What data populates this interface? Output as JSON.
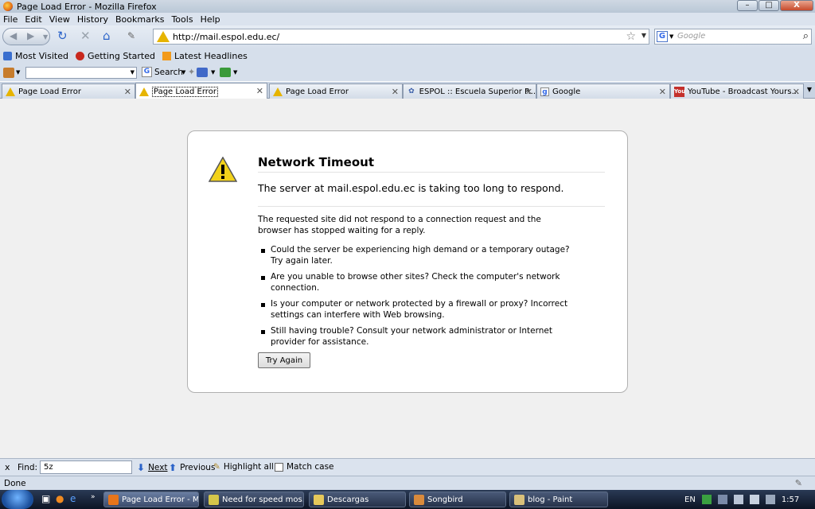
{
  "window": {
    "title": "Page Load Error - Mozilla Firefox",
    "min": "–",
    "max": "□",
    "close": "X"
  },
  "menu": [
    "File",
    "Edit",
    "View",
    "History",
    "Bookmarks",
    "Tools",
    "Help"
  ],
  "nav": {
    "url": "http://mail.espol.edu.ec/",
    "search_placeholder": "Google"
  },
  "bookmarks": [
    "Most Visited",
    "Getting Started",
    "Latest Headlines"
  ],
  "toolbar2": {
    "search_label": "Search"
  },
  "tabs": [
    {
      "label": "Page Load Error",
      "active": false
    },
    {
      "label": "Page Load Error",
      "active": true
    },
    {
      "label": "Page Load Error",
      "active": false
    },
    {
      "label": "ESPOL :: Escuela Superior P...",
      "active": false
    },
    {
      "label": "Google",
      "active": false
    },
    {
      "label": "YouTube - Broadcast Yours...",
      "active": false
    }
  ],
  "error": {
    "title": "Network Timeout",
    "short": "The server at mail.espol.edu.ec is taking too long to respond.",
    "long": "The requested site did not respond to a connection request and the browser has stopped waiting for a reply.",
    "items": [
      "Could the server be experiencing high demand or a temporary outage? Try again later.",
      "Are you unable to browse other sites? Check the computer's network connection.",
      "Is your computer or network protected by a firewall or proxy? Incorrect settings can interfere with Web browsing.",
      "Still having trouble? Consult your network administrator or Internet provider for assistance."
    ],
    "button": "Try Again"
  },
  "findbar": {
    "close": "x",
    "label": "Find:",
    "value": "5z",
    "next": "Next",
    "previous": "Previous",
    "highlight": "Highlight all",
    "matchcase": "Match case"
  },
  "status": "Done",
  "taskbar": {
    "tasks": [
      {
        "label": "Page Load Error - M...",
        "active": true,
        "color": "#e8751a"
      },
      {
        "label": "Need for speed mos...",
        "active": false,
        "color": "#d4c64a"
      },
      {
        "label": "Descargas",
        "active": false,
        "color": "#e6c85a"
      },
      {
        "label": "Songbird",
        "active": false,
        "color": "#d98a3c"
      },
      {
        "label": "blog - Paint",
        "active": false,
        "color": "#d9c07a"
      }
    ],
    "lang": "EN",
    "time": "1:57"
  }
}
